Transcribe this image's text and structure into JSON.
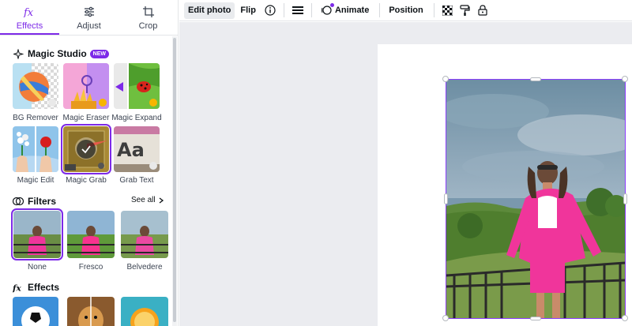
{
  "tabs": [
    {
      "label": "Effects",
      "icon": "fx-icon",
      "active": true
    },
    {
      "label": "Adjust",
      "icon": "sliders-icon",
      "active": false
    },
    {
      "label": "Crop",
      "icon": "crop-icon",
      "active": false
    }
  ],
  "magic_studio": {
    "title": "Magic Studio",
    "badge": "NEW",
    "tools": [
      {
        "label": "BG Remover"
      },
      {
        "label": "Magic Eraser"
      },
      {
        "label": "Magic Expand"
      },
      {
        "label": "Magic Edit"
      },
      {
        "label": "Magic Grab",
        "selected": true
      },
      {
        "label": "Grab Text",
        "tile_text": "Aa"
      }
    ]
  },
  "filters": {
    "title": "Filters",
    "see_all": "See all",
    "items": [
      {
        "label": "None",
        "selected": true
      },
      {
        "label": "Fresco"
      },
      {
        "label": "Belvedere"
      }
    ]
  },
  "effects": {
    "title": "Effects"
  },
  "toolbar": {
    "edit_photo": "Edit photo",
    "flip": "Flip",
    "animate": "Animate",
    "position": "Position",
    "icons": [
      "info-icon",
      "lines-icon",
      "animate-icon",
      "transparency-icon",
      "paint-roller-icon",
      "lock-icon"
    ]
  },
  "colors": {
    "accent": "#7d2ae8",
    "selection": "#8b3dff",
    "pink_outfit": "#f0359b"
  }
}
